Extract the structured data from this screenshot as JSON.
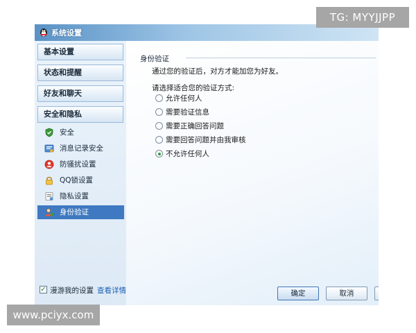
{
  "watermarks": {
    "top": "TG: MYYJJPP",
    "bottom": "www.pciyx.com"
  },
  "window": {
    "title": "系统设置"
  },
  "sidebar": {
    "categories": [
      {
        "label": "基本设置"
      },
      {
        "label": "状态和提醒"
      },
      {
        "label": "好友和聊天"
      },
      {
        "label": "安全和隐私"
      }
    ],
    "items": [
      {
        "label": "安全",
        "icon": "shield-icon"
      },
      {
        "label": "消息记录安全",
        "icon": "chat-record-icon"
      },
      {
        "label": "防骚扰设置",
        "icon": "anti-harass-icon"
      },
      {
        "label": "QQ锁设置",
        "icon": "lock-icon"
      },
      {
        "label": "隐私设置",
        "icon": "privacy-icon"
      },
      {
        "label": "身份验证",
        "icon": "user-verify-icon",
        "selected": true
      }
    ],
    "footer": {
      "checkbox_label": "漫游我的设置",
      "checked": true,
      "link_label": "查看详情"
    }
  },
  "content": {
    "section_title": "身份验证",
    "description": "通过您的验证后，对方才能加您为好友。",
    "prompt": "请选择适合您的验证方式:",
    "options": [
      {
        "label": "允许任何人",
        "checked": false
      },
      {
        "label": "需要验证信息",
        "checked": false
      },
      {
        "label": "需要正确回答问题",
        "checked": false
      },
      {
        "label": "需要回答问题并由我审核",
        "checked": false
      },
      {
        "label": "不允许任何人",
        "checked": true
      }
    ]
  },
  "buttons": {
    "ok": "确定",
    "cancel": "取消"
  },
  "colors": {
    "selected_bg": "#3e79c1",
    "link": "#1f62b7",
    "radio_dot": "#2f9d3a"
  }
}
